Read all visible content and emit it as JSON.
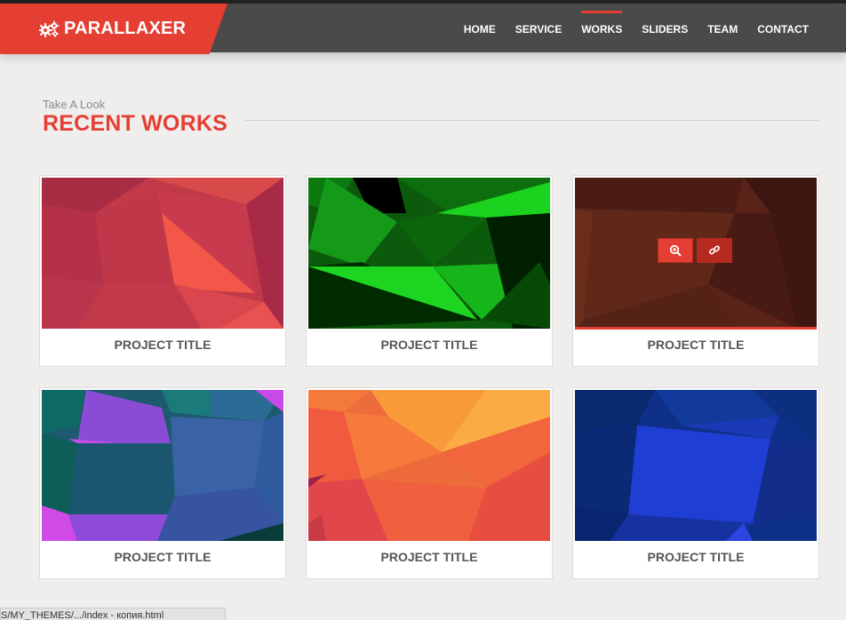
{
  "brand": {
    "name": "PARALLAXER",
    "icon": "gears-icon",
    "color": "#e53f33"
  },
  "nav": [
    {
      "label": "HOME",
      "active": false
    },
    {
      "label": "SERVICE",
      "active": false
    },
    {
      "label": "WORKS",
      "active": true
    },
    {
      "label": "SLIDERS",
      "active": false
    },
    {
      "label": "TEAM",
      "active": false
    },
    {
      "label": "CONTACT",
      "active": false
    }
  ],
  "section": {
    "subtitle": "Take A Look",
    "title": "RECENT WORKS"
  },
  "projects": [
    {
      "title": "PROJECT TITLE",
      "palette": "red"
    },
    {
      "title": "PROJECT TITLE",
      "palette": "green"
    },
    {
      "title": "PROJECT TITLE",
      "palette": "brown",
      "hovered": true,
      "actions": [
        "zoom-icon",
        "link-icon"
      ]
    },
    {
      "title": "PROJECT TITLE",
      "palette": "teal-purple"
    },
    {
      "title": "PROJECT TITLE",
      "palette": "orange"
    },
    {
      "title": "PROJECT TITLE",
      "palette": "blue"
    }
  ],
  "status_url": "S/MY_THEMES/.../index - копия.html"
}
